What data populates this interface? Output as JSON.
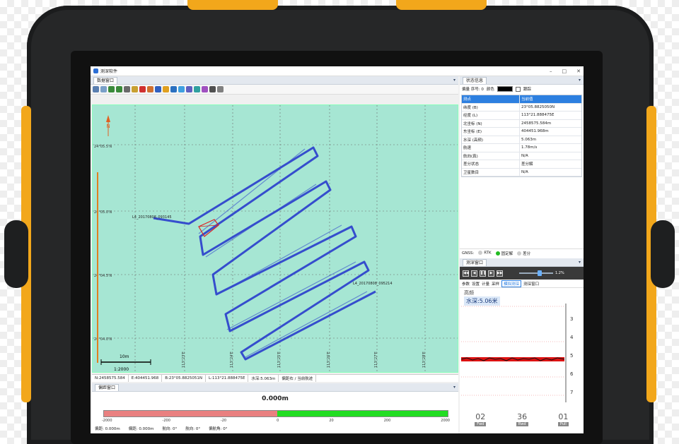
{
  "window": {
    "title": "测深软件",
    "minimize": "–",
    "maximize": "□",
    "close": "✕"
  },
  "map_panel": {
    "tab": "数据窗口",
    "pin": "▾"
  },
  "map": {
    "north": "N",
    "lat_labels": [
      "24°05.5'N",
      "24°05.0'N",
      "24°04.5'N",
      "24°04.0'N"
    ],
    "lon_labels": [
      "113°22'E",
      "113°23'E",
      "113°24'E",
      "113°25'E",
      "113°26'E",
      "113°27'E",
      "113°28'E"
    ],
    "line_label_start": "L4_20170808_093145",
    "line_label_end": "L4_20170808_095214",
    "scale_text": "10m",
    "scale_ratio": "1:2000",
    "track_color": "#2233cc",
    "vessel_color": "#dd2222"
  },
  "status_bar": [
    "N:2458575.584",
    "E:404451.968",
    "B:23°05.8825051N",
    "L:113°21.888475E",
    "水深:5.063m",
    "偏距右 / 当前航迹"
  ],
  "deviation_panel": {
    "tab": "偏距窗口",
    "value": "0.000m",
    "ticks": [
      "-2000",
      "-200",
      "-20",
      "0",
      "20",
      "200",
      "2000"
    ],
    "info": [
      "偏距: 0.000m",
      "偏距: 0.000m",
      "航向: 0°",
      "航向: 0°",
      "偏航角: 0°"
    ]
  },
  "props_panel": {
    "tab": "状态信息",
    "options": {
      "label": "偏量 序号: 0",
      "color_label": "颜色",
      "checkbox_label": "跟踪"
    },
    "rows": [
      {
        "k": "测点",
        "v": "当前值"
      },
      {
        "k": "纬度 (B)",
        "v": "23°05.8825050N"
      },
      {
        "k": "经度 (L)",
        "v": "113°21.888475E"
      },
      {
        "k": "北坐标 (N)",
        "v": "2458575.584m"
      },
      {
        "k": "东坐标 (E)",
        "v": "404451.968m"
      },
      {
        "k": "水深 (高频)",
        "v": "5.063m"
      },
      {
        "k": "航速",
        "v": "1.78m/s"
      },
      {
        "k": "航向(真)",
        "v": "N/A"
      },
      {
        "k": "差分状态",
        "v": "差分解"
      },
      {
        "k": "卫星数目",
        "v": "N/A"
      }
    ],
    "gnss": {
      "label": "GNSS:",
      "a": "RTK",
      "b": "固定解",
      "c": "差分"
    }
  },
  "sounder": {
    "tab": "测深窗口",
    "zoom": "1.2%",
    "tabs": [
      "参数",
      "设置",
      "计量",
      "采样",
      "模拟测深",
      "测深窗口"
    ],
    "active_tab": "模拟测深",
    "depth_title": "高频",
    "depth_readout": "水深:5.06米",
    "axis_ticks": [
      "3",
      "4",
      "5",
      "6",
      "7"
    ],
    "counters": [
      {
        "value": "02",
        "label": "Fwd"
      },
      {
        "value": "36",
        "label": "Rwd"
      },
      {
        "value": "01",
        "label": "Pull"
      }
    ]
  }
}
